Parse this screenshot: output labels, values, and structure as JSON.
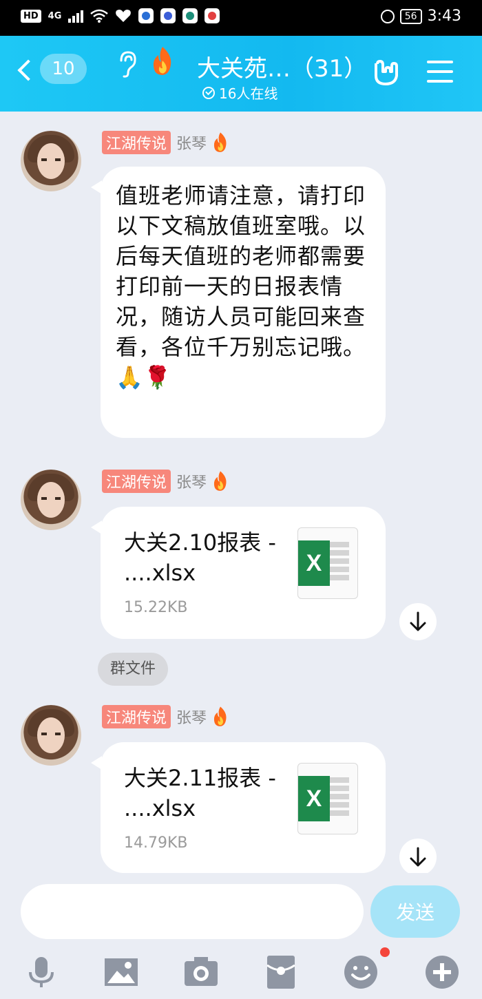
{
  "status_bar": {
    "hd_badge": "HD",
    "network": "4G",
    "battery": "56",
    "time": "3:43"
  },
  "header": {
    "back_count": "10",
    "group_title": "大关苑…（31）",
    "online_text": "16人在线"
  },
  "messages": [
    {
      "badge": "江湖传说",
      "sender": "张琴",
      "text": "值班老师请注意，请打印以下文稿放值班室哦。以后每天值班的老师都需要打印前一天的日报表情况，随访人员可能回来查看，各位千万别忘记哦。🙏🌹"
    },
    {
      "badge": "江湖传说",
      "sender": "张琴",
      "file_name": "大关2.10报表 - ....xlsx",
      "file_size": "15.22KB"
    },
    {
      "badge": "江湖传说",
      "sender": "张琴",
      "file_name": "大关2.11报表 - ....xlsx",
      "file_size": "14.79KB"
    }
  ],
  "system_tag": "群文件",
  "input": {
    "value": "",
    "send_label": "发送"
  },
  "colors": {
    "header_blue": "#13b9f0",
    "badge_red": "#f7877b",
    "send_disabled": "#a6e4f8",
    "excel_green": "#1e8a4c",
    "icon_gray": "#8f96a3"
  }
}
